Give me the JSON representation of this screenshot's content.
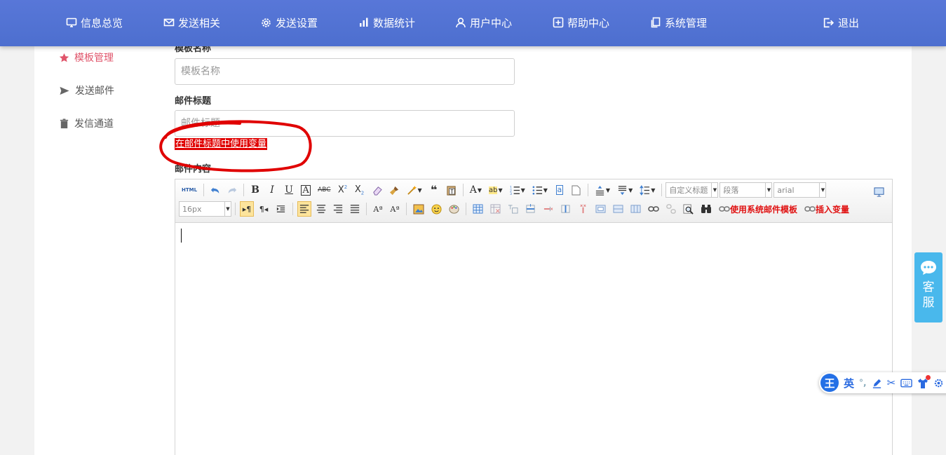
{
  "nav": {
    "items": [
      {
        "label": "信息总览",
        "icon": "monitor-icon"
      },
      {
        "label": "发送相关",
        "icon": "envelope-icon"
      },
      {
        "label": "发送设置",
        "icon": "gear-icon"
      },
      {
        "label": "数据统计",
        "icon": "bar-chart-icon"
      },
      {
        "label": "用户中心",
        "icon": "user-icon"
      },
      {
        "label": "帮助中心",
        "icon": "help-box-icon"
      },
      {
        "label": "系统管理",
        "icon": "copy-icon"
      }
    ],
    "logout": {
      "label": "退出",
      "icon": "logout-icon"
    }
  },
  "sidebar": {
    "items": [
      {
        "label": "模板管理",
        "icon": "star-icon",
        "active": true
      },
      {
        "label": "发送邮件",
        "icon": "send-icon",
        "active": false
      },
      {
        "label": "发信通道",
        "icon": "trash-icon",
        "active": false
      }
    ]
  },
  "form": {
    "template_name": {
      "label": "模板名称",
      "placeholder": "模板名称",
      "value": ""
    },
    "subject": {
      "label": "邮件标题",
      "placeholder": "邮件标题",
      "value": ""
    },
    "use_variable_link": "在邮件标题中使用变量",
    "content_label": "邮件内容"
  },
  "editor": {
    "font_size": "16px",
    "custom_heading": "自定义标题",
    "paragraph": "段落",
    "font_family": "arial",
    "use_system_template": "使用系统邮件模板",
    "insert_variable": "插入变量",
    "html_button": "HTML",
    "content": ""
  },
  "customer_service": {
    "line1": "客",
    "line2": "服"
  },
  "ime": {
    "logo": "王",
    "mode": "英"
  },
  "colors": {
    "nav_bg": "#5073d4",
    "active": "#e0556b",
    "annotation": "#e00000",
    "cs_widget": "#49b8ec",
    "link_red": "#e01111"
  }
}
